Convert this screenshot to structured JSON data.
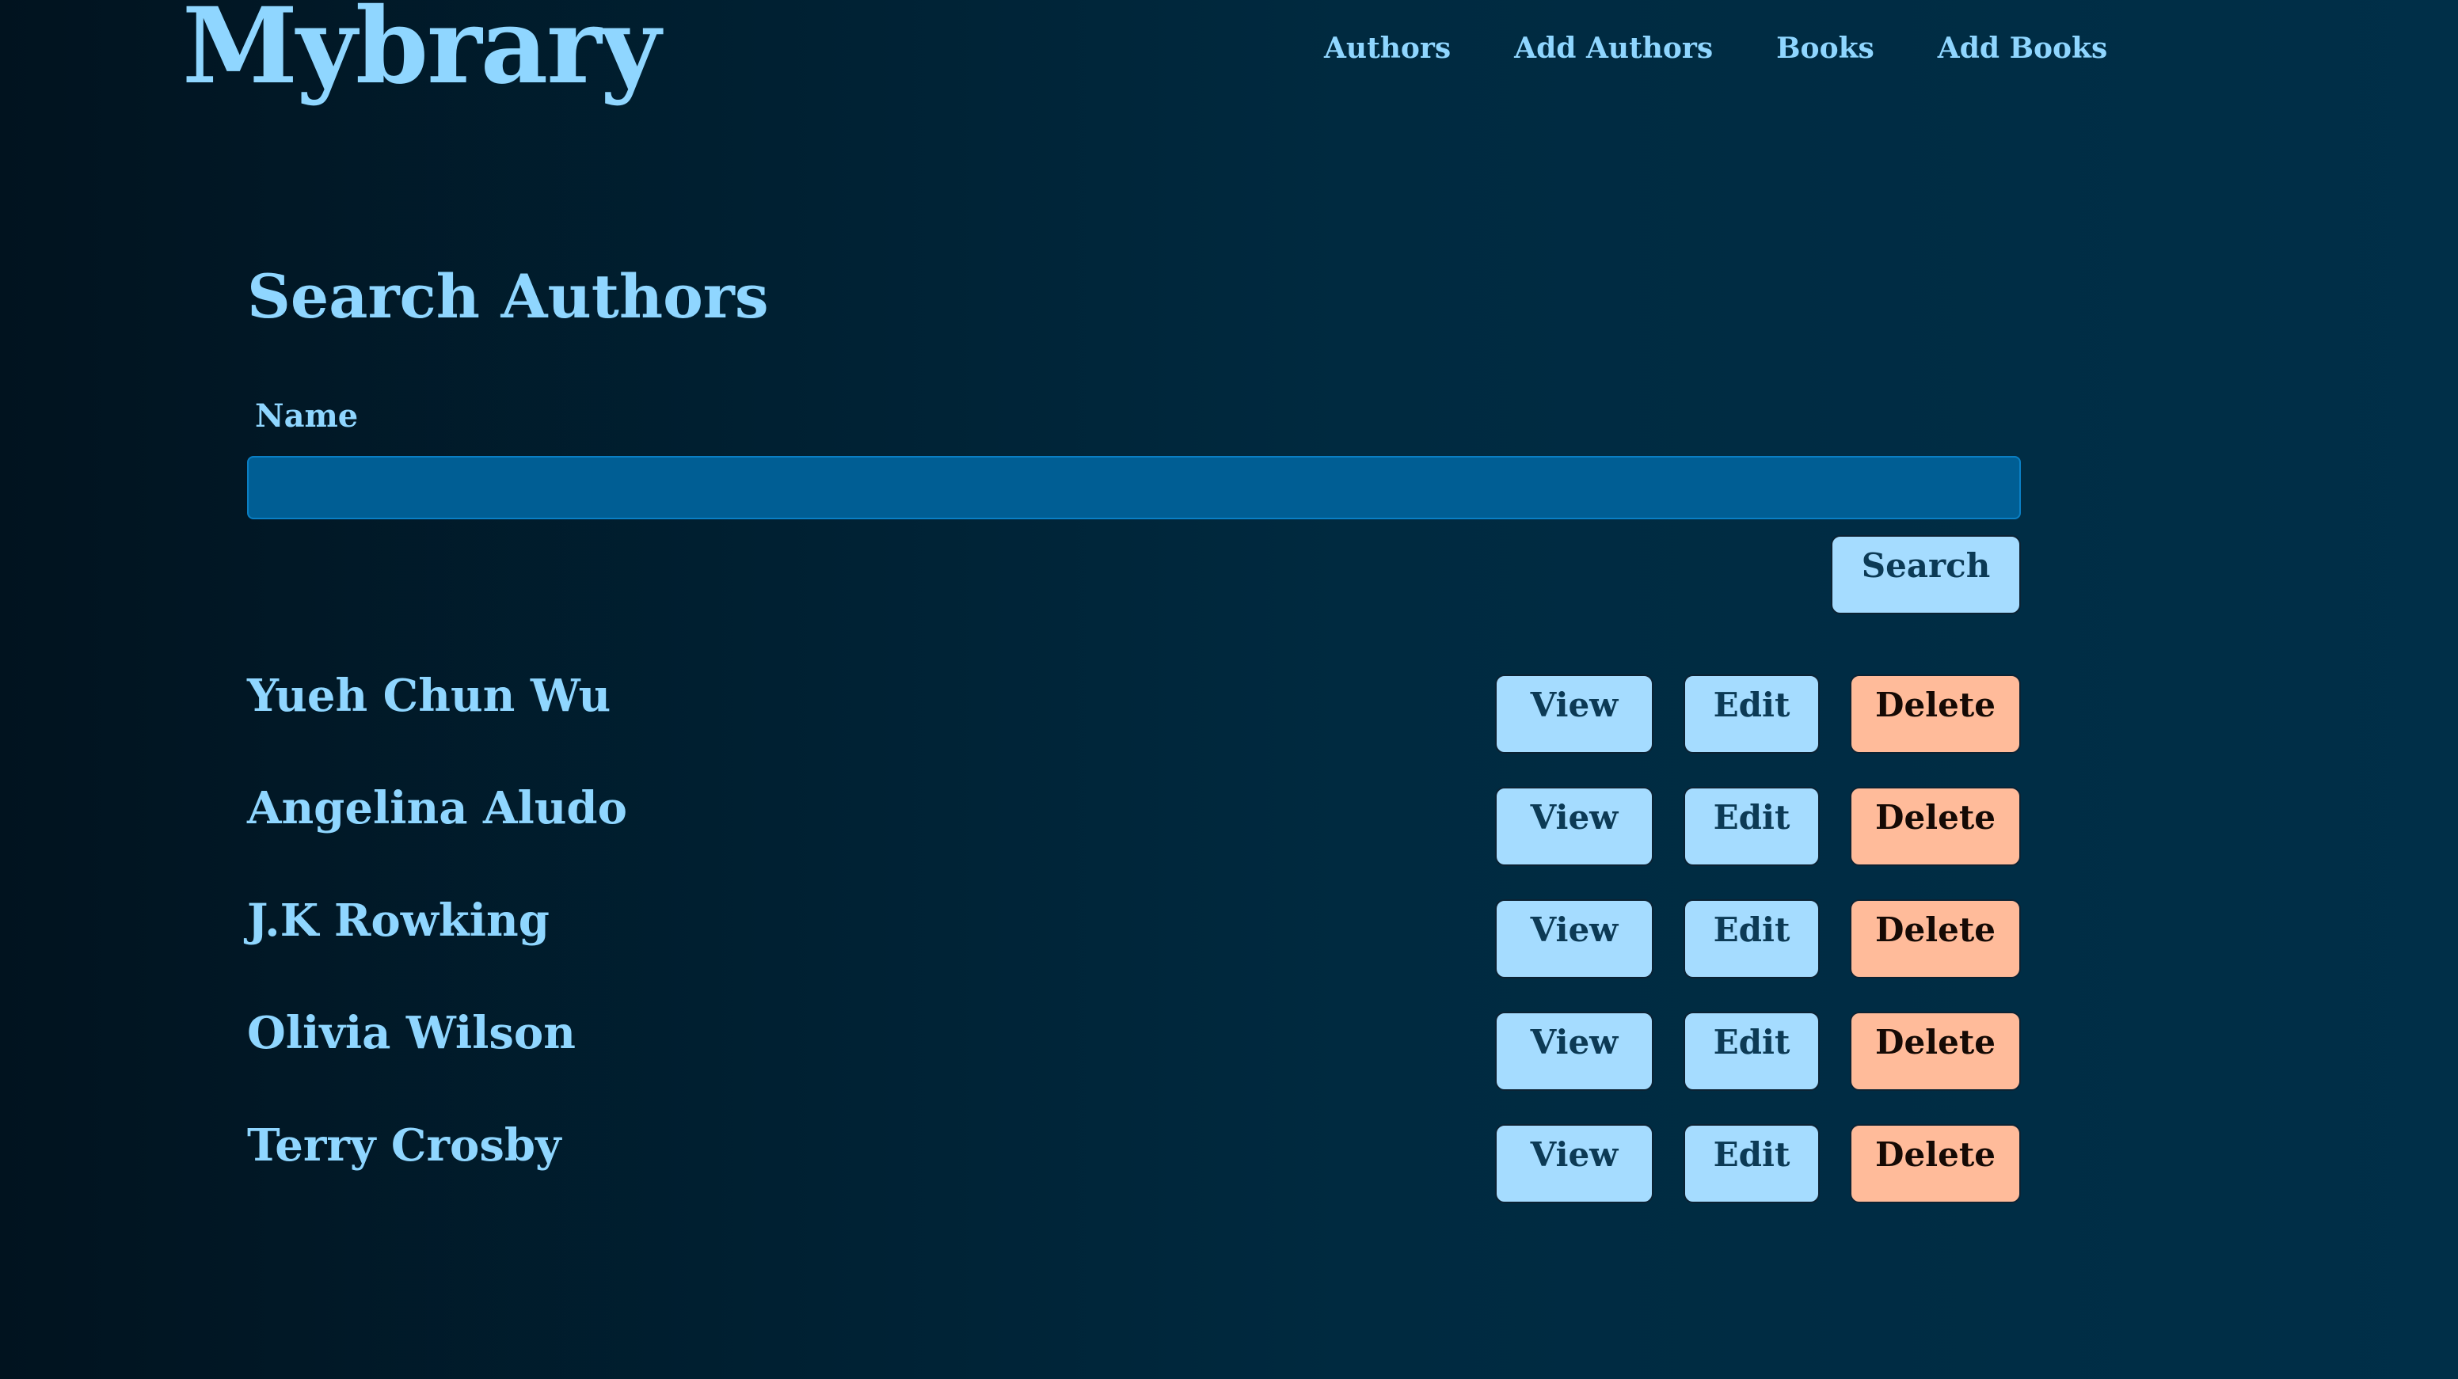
{
  "header": {
    "logo": "Mybrary",
    "nav": [
      {
        "label": "Authors"
      },
      {
        "label": "Add Authors"
      },
      {
        "label": "Books"
      },
      {
        "label": "Add Books"
      }
    ]
  },
  "main": {
    "title": "Search Authors",
    "search": {
      "label": "Name",
      "value": "",
      "placeholder": "",
      "button_label": "Search"
    },
    "authors": [
      {
        "name": "Yueh Chun Wu",
        "view_label": "View",
        "edit_label": "Edit",
        "delete_label": "Delete"
      },
      {
        "name": "Angelina Aludo",
        "view_label": "View",
        "edit_label": "Edit",
        "delete_label": "Delete"
      },
      {
        "name": "J.K Rowking",
        "view_label": "View",
        "edit_label": "Edit",
        "delete_label": "Delete"
      },
      {
        "name": "Olivia Wilson",
        "view_label": "View",
        "edit_label": "Edit",
        "delete_label": "Delete"
      },
      {
        "name": "Terry Crosby",
        "view_label": "View",
        "edit_label": "Edit",
        "delete_label": "Delete"
      }
    ]
  },
  "colors": {
    "background": "#001b2b",
    "accent": "#8fd6ff",
    "button_primary": "#a5dcff",
    "button_danger": "#ffbb9a",
    "input_background": "#005e94"
  }
}
